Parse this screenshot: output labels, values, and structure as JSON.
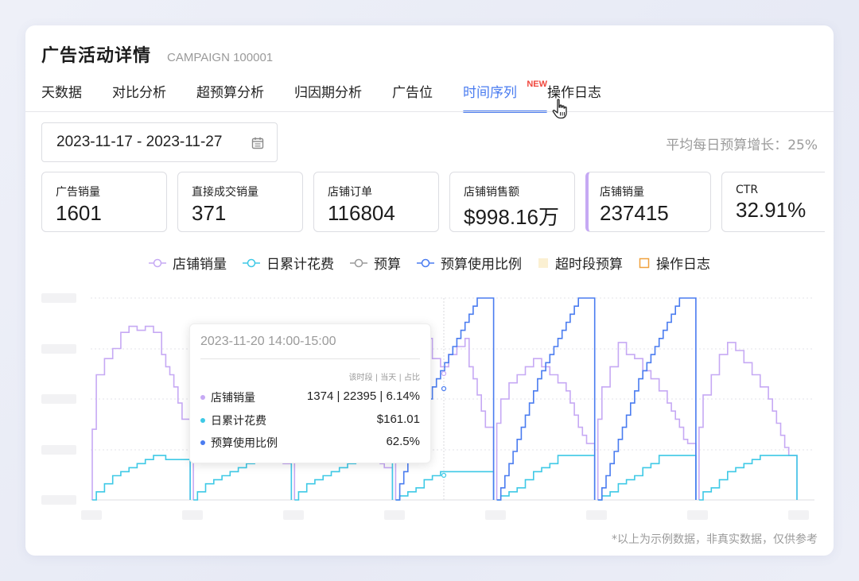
{
  "header": {
    "title": "广告活动详情",
    "campaign_id": "CAMPAIGN 100001"
  },
  "tabs": [
    {
      "label": "天数据"
    },
    {
      "label": "对比分析"
    },
    {
      "label": "超预算分析"
    },
    {
      "label": "归因期分析"
    },
    {
      "label": "广告位"
    },
    {
      "label": "时间序列",
      "active": true,
      "badge": "NEW"
    },
    {
      "label": "操作日志"
    }
  ],
  "filters": {
    "date_range": "2023-11-17 - 2023-11-27",
    "avg_growth": "平均每日预算增长：25%"
  },
  "kpis": [
    {
      "label": "广告销量",
      "value": "1601"
    },
    {
      "label": "直接成交销量",
      "value": "371"
    },
    {
      "label": "店铺订单",
      "value": "116804"
    },
    {
      "label": "店铺销售额",
      "value": "$998.16万"
    },
    {
      "label": "店铺销量",
      "value": "237415",
      "selected": true
    },
    {
      "label": "CTR",
      "value": "32.91%"
    }
  ],
  "legend": [
    {
      "label": "店铺销量",
      "color": "#c6a9f4",
      "icon": "circle-line"
    },
    {
      "label": "日累计花费",
      "color": "#3ec9e6",
      "icon": "circle-line"
    },
    {
      "label": "预算",
      "color": "#9a9a9a",
      "icon": "circle-line"
    },
    {
      "label": "预算使用比例",
      "color": "#4a7cf0",
      "icon": "circle-line"
    },
    {
      "label": "超时段预算",
      "color": "#fbf0d2",
      "icon": "square-fill"
    },
    {
      "label": "操作日志",
      "color": "#f0a13e",
      "icon": "square-outline"
    }
  ],
  "tooltip": {
    "time": "2023-11-20 14:00-15:00",
    "header": "该时段 | 当天 | 占比",
    "rows": [
      {
        "name": "店铺销量",
        "value": "1374 | 22395 | 6.14%",
        "color": "#c6a9f4"
      },
      {
        "name": "日累计花费",
        "value": "$161.01",
        "color": "#3ec9e6"
      },
      {
        "name": "预算使用比例",
        "value": "62.5%",
        "color": "#4a7cf0"
      }
    ]
  },
  "footnote": "*以上为示例数据，非真实数据，仅供参考",
  "chart_data": {
    "type": "line",
    "title": "",
    "xlabel": "",
    "ylabel": "",
    "grid": true,
    "x_ticks_hidden": true,
    "y_ticks_hidden": true,
    "days": 7,
    "hours_per_day": 24,
    "series": [
      {
        "name": "店铺销量",
        "color": "#c6a9f4",
        "shape": "step",
        "days": [
          [
            0.35,
            0.62,
            0.62,
            0.7,
            0.7,
            0.75,
            0.75,
            0.83,
            0.83,
            0.86,
            0.86,
            0.84,
            0.84,
            0.86,
            0.86,
            0.83,
            0.83,
            0.72,
            0.66,
            0.62,
            0.56,
            0.48,
            0.4,
            0.4
          ],
          [
            0.2,
            0.38,
            0.38,
            0.55,
            0.55,
            0.62,
            0.62,
            0.66,
            0.66,
            0.6,
            0.6,
            0.52,
            0.52,
            0.48,
            0.48,
            0.44,
            0.44,
            0.4,
            0.36,
            0.3,
            0.26,
            0.2,
            0.18,
            0.18
          ],
          [
            0.22,
            0.42,
            0.42,
            0.56,
            0.56,
            0.66,
            0.66,
            0.7,
            0.7,
            0.64,
            0.64,
            0.56,
            0.56,
            0.5,
            0.5,
            0.46,
            0.46,
            0.4,
            0.34,
            0.28,
            0.22,
            0.18,
            0.16,
            0.16
          ],
          [
            0.3,
            0.48,
            0.48,
            0.64,
            0.64,
            0.74,
            0.74,
            0.8,
            0.8,
            0.7,
            0.7,
            0.66,
            0.66,
            0.72,
            0.72,
            0.76,
            0.76,
            0.8,
            0.66,
            0.6,
            0.52,
            0.44,
            0.36,
            0.36
          ],
          [
            0.38,
            0.5,
            0.5,
            0.58,
            0.58,
            0.62,
            0.62,
            0.66,
            0.66,
            0.7,
            0.7,
            0.66,
            0.66,
            0.62,
            0.62,
            0.58,
            0.58,
            0.54,
            0.48,
            0.42,
            0.36,
            0.32,
            0.28,
            0.28
          ],
          [
            0.4,
            0.56,
            0.56,
            0.66,
            0.66,
            0.78,
            0.78,
            0.72,
            0.72,
            0.7,
            0.7,
            0.64,
            0.64,
            0.6,
            0.6,
            0.54,
            0.54,
            0.48,
            0.44,
            0.4,
            0.36,
            0.3,
            0.28,
            0.28
          ],
          [
            0.36,
            0.52,
            0.52,
            0.62,
            0.62,
            0.72,
            0.72,
            0.78,
            0.78,
            0.74,
            0.74,
            0.68,
            0.68,
            0.62,
            0.62,
            0.56,
            0.56,
            0.5,
            0.44,
            0.38,
            0.32,
            0.26,
            0.22,
            0.22
          ]
        ]
      },
      {
        "name": "日累计花费",
        "color": "#3ec9e6",
        "shape": "step",
        "days": [
          [
            0.0,
            0.04,
            0.04,
            0.08,
            0.08,
            0.12,
            0.12,
            0.14,
            0.14,
            0.16,
            0.16,
            0.18,
            0.18,
            0.2,
            0.2,
            0.22,
            0.22,
            0.22,
            0.2,
            0.2,
            0.2,
            0.2,
            0.2,
            0.2
          ],
          [
            0.0,
            0.04,
            0.04,
            0.08,
            0.08,
            0.1,
            0.1,
            0.12,
            0.12,
            0.14,
            0.14,
            0.16,
            0.16,
            0.18,
            0.18,
            0.2,
            0.2,
            0.22,
            0.22,
            0.22,
            0.22,
            0.22,
            0.22,
            0.22
          ],
          [
            0.0,
            0.04,
            0.04,
            0.08,
            0.08,
            0.1,
            0.1,
            0.12,
            0.12,
            0.14,
            0.14,
            0.16,
            0.16,
            0.18,
            0.18,
            0.2,
            0.2,
            0.22,
            0.22,
            0.22,
            0.22,
            0.22,
            0.22,
            0.22
          ],
          [
            0.0,
            0.02,
            0.02,
            0.04,
            0.04,
            0.06,
            0.06,
            0.1,
            0.1,
            0.12,
            0.12,
            0.14,
            0.14,
            0.14,
            0.14,
            0.14,
            0.14,
            0.14,
            0.14,
            0.14,
            0.14,
            0.14,
            0.14,
            0.14
          ],
          [
            0.0,
            0.02,
            0.02,
            0.04,
            0.04,
            0.06,
            0.06,
            0.1,
            0.1,
            0.14,
            0.14,
            0.16,
            0.16,
            0.18,
            0.18,
            0.22,
            0.22,
            0.22,
            0.22,
            0.22,
            0.22,
            0.22,
            0.22,
            0.22
          ],
          [
            0.0,
            0.02,
            0.02,
            0.04,
            0.04,
            0.08,
            0.08,
            0.1,
            0.1,
            0.12,
            0.12,
            0.16,
            0.16,
            0.18,
            0.18,
            0.22,
            0.22,
            0.22,
            0.22,
            0.22,
            0.22,
            0.22,
            0.22,
            0.22
          ],
          [
            0.0,
            0.04,
            0.04,
            0.06,
            0.06,
            0.1,
            0.1,
            0.14,
            0.14,
            0.16,
            0.16,
            0.18,
            0.18,
            0.2,
            0.2,
            0.22,
            0.22,
            0.22,
            0.22,
            0.22,
            0.22,
            0.22,
            0.22,
            0.22
          ]
        ]
      },
      {
        "name": "预算使用比例",
        "color": "#4a7cf0",
        "shape": "step",
        "days": [
          null,
          null,
          null,
          [
            0.0,
            0.08,
            0.14,
            0.2,
            0.26,
            0.32,
            0.38,
            0.44,
            0.5,
            0.56,
            0.6,
            0.64,
            0.68,
            0.72,
            0.76,
            0.8,
            0.84,
            0.88,
            0.92,
            0.96,
            1.0,
            1.0,
            1.0,
            1.0
          ],
          [
            0.0,
            0.06,
            0.12,
            0.18,
            0.24,
            0.3,
            0.36,
            0.42,
            0.48,
            0.54,
            0.6,
            0.64,
            0.68,
            0.72,
            0.76,
            0.8,
            0.84,
            0.88,
            0.92,
            0.96,
            1.0,
            1.0,
            1.0,
            1.0
          ],
          [
            0.0,
            0.06,
            0.12,
            0.18,
            0.24,
            0.3,
            0.36,
            0.42,
            0.48,
            0.54,
            0.6,
            0.64,
            0.68,
            0.72,
            0.76,
            0.8,
            0.84,
            0.88,
            0.92,
            0.96,
            1.0,
            1.0,
            1.0,
            1.0
          ],
          null
        ]
      }
    ]
  }
}
